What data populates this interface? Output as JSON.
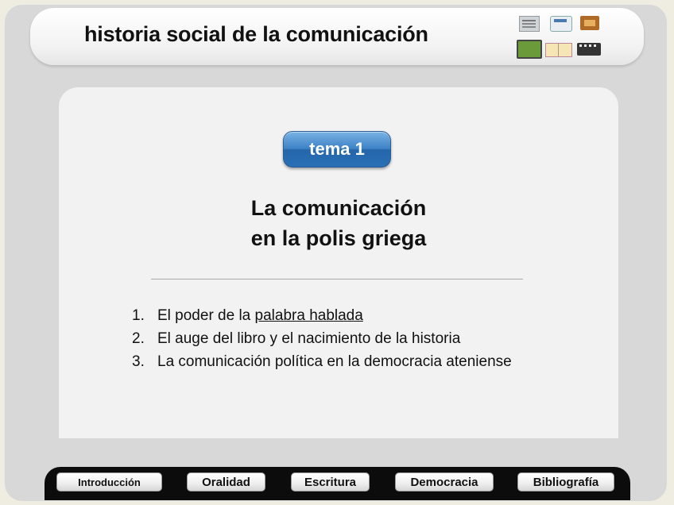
{
  "header": {
    "title": "historia social de la comunicación",
    "icons": [
      "newspaper-icon",
      "radio-icon",
      "box-icon",
      "television-icon",
      "book-icon",
      "film-icon"
    ]
  },
  "content": {
    "topic_button": "tema 1",
    "title_line1": "La comunicación",
    "title_line2": "en la polis griega",
    "outline": [
      {
        "number": "1.",
        "text": "El poder de la ",
        "link": "palabra hablada"
      },
      {
        "number": "2.",
        "text": "El auge del libro y el nacimiento de la historia"
      },
      {
        "number": "3.",
        "text": "La comunicación política en la democracia ateniense"
      }
    ]
  },
  "nav": {
    "items": [
      "Introducción",
      "Oralidad",
      "Escritura",
      "Democracia",
      "Bibliografía"
    ]
  },
  "colors": {
    "accent": "#3d82c6",
    "navbar": "#0c0c0c",
    "background": "#d8d8d8"
  }
}
